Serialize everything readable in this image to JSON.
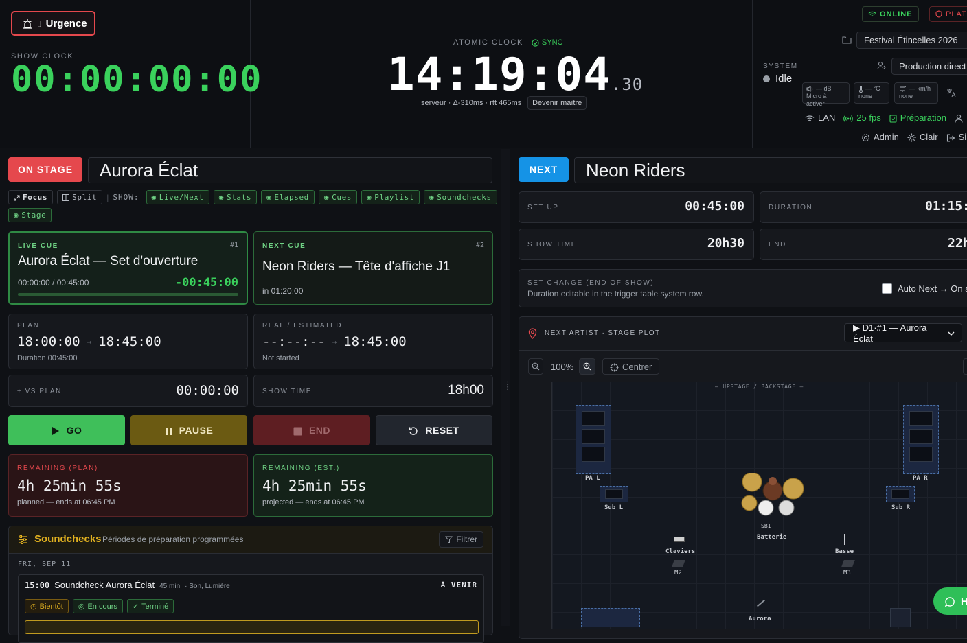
{
  "header": {
    "urgence_label": "Urgence",
    "show_clock_label": "SHOW CLOCK",
    "show_clock_value": "00:00:00:00",
    "atomic_label": "ATOMIC CLOCK",
    "sync_label": "SYNC",
    "atomic_time": "14:19:04",
    "atomic_frac": ".30",
    "server_info": "serveur · Δ-310ms · rtt 465ms",
    "become_master": "Devenir maître",
    "online_label": "ONLINE",
    "platform_label": "PLATF",
    "festival_value": "Festival Étincelles 2026",
    "role_value": "Production direct",
    "system_label": "SYSTEM",
    "system_status": "Idle",
    "mic_value": "— dB",
    "mic_sub": "Micro à activer",
    "temp_value": "— °C",
    "temp_sub": "none",
    "wind_value": "— km/h",
    "wind_sub": "none",
    "lan_label": "LAN",
    "fps_label": "25 fps",
    "prep_label": "Préparation",
    "admin_label": "Admin",
    "theme_label": "Clair",
    "signout_label": "Si"
  },
  "left": {
    "on_stage_label": "ON STAGE",
    "artist_name": "Aurora Éclat",
    "focus_label": "Focus",
    "split_label": "Split",
    "show_label": "SHOW:",
    "show_chips": [
      "Live/Next",
      "Stats",
      "Elapsed",
      "Cues",
      "Playlist",
      "Soundchecks",
      "Stage"
    ],
    "live_cue": {
      "label": "LIVE CUE",
      "num": "#1",
      "title": "Aurora Éclat — Set d'ouverture",
      "progress": "00:00:00 / 00:45:00",
      "countdown": "-00:45:00",
      "progress_fraction": 0
    },
    "next_cue": {
      "label": "NEXT CUE",
      "num": "#2",
      "title": "Neon Riders — Tête d'affiche J1",
      "in": "in 01:20:00"
    },
    "plan": {
      "label": "PLAN",
      "start": "18:00:00",
      "end": "18:45:00",
      "duration": "Duration 00:45:00"
    },
    "real": {
      "label": "REAL / ESTIMATED",
      "start": "--:--:--",
      "end": "18:45:00",
      "status": "Not started"
    },
    "vs_plan": {
      "label": "± VS PLAN",
      "value": "00:00:00"
    },
    "show_time": {
      "label": "SHOW TIME",
      "value": "18h00"
    },
    "buttons": {
      "go": "GO",
      "pause": "PAUSE",
      "end": "END",
      "reset": "RESET"
    },
    "remaining_plan": {
      "label": "REMAINING (PLAN)",
      "value": "4h 25min 55s",
      "sub": "planned — ends at 06:45 PM"
    },
    "remaining_est": {
      "label": "REMAINING (EST.)",
      "value": "4h 25min 55s",
      "sub": "projected — ends at 06:45 PM"
    },
    "soundchecks": {
      "title": "Soundchecks",
      "subtitle": "Périodes de préparation programmées",
      "filter_label": "Filtrer",
      "date": "FRI, SEP 11",
      "item": {
        "time": "15:00",
        "name": "Soundcheck Aurora Éclat",
        "duration": "45 min",
        "depts": "· Son, Lumière",
        "status": "À VENIR"
      },
      "tags": [
        "Bientôt",
        "En cours",
        "Terminé"
      ]
    }
  },
  "right": {
    "next_label": "NEXT",
    "artist_name": "Neon Riders",
    "setup": {
      "label": "SET UP",
      "value": "00:45:00"
    },
    "duration": {
      "label": "DURATION",
      "value": "01:15:"
    },
    "show_time": {
      "label": "SHOW TIME",
      "value": "20h30"
    },
    "end": {
      "label": "END",
      "value": "22h"
    },
    "set_change": {
      "label": "SET CHANGE (END OF SHOW)",
      "sub": "Duration editable in the trigger table system row.",
      "auto_next": "Auto Next → On s"
    },
    "stage_plot": {
      "title": "NEXT ARTIST · STAGE PLOT",
      "select_value": "▶ D1·#1 — Aurora Éclat",
      "zoom": "100%",
      "center_label": "Centrer",
      "upstage_label": "— UPSTAGE / BACKSTAGE —",
      "equipment": {
        "pa_l": "PA L",
        "pa_r": "PA R",
        "sub_l": "Sub L",
        "sub_r": "Sub R",
        "sb1": "SB1",
        "drums": "Batterie",
        "keys": "Claviers",
        "m2": "M2",
        "bass": "Basse",
        "m3": "M3",
        "vocal": "Aurora"
      }
    },
    "help_label": "H"
  }
}
